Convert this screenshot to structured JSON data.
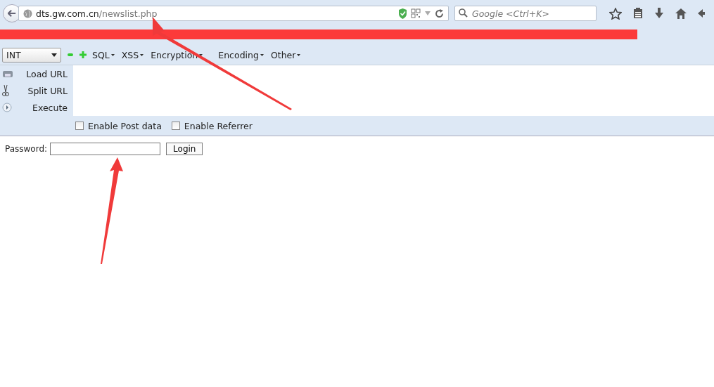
{
  "browser": {
    "url": {
      "host": "dts.gw.com.cn",
      "path": "/newslist.php"
    },
    "search": {
      "placeholder": "Google <Ctrl+K>"
    }
  },
  "hackbar": {
    "select": "INT",
    "menus": [
      "SQL",
      "XSS",
      "Encryption",
      "Encoding",
      "Other"
    ],
    "actions": [
      {
        "kind": "load",
        "label": "Load URL"
      },
      {
        "kind": "split",
        "label": "Split URL"
      },
      {
        "kind": "execute",
        "label": "Execute"
      }
    ],
    "options": [
      {
        "label": "Enable Post data",
        "checked": false
      },
      {
        "label": "Enable Referrer",
        "checked": false
      }
    ]
  },
  "page": {
    "label": "Password:",
    "button": "Login"
  }
}
